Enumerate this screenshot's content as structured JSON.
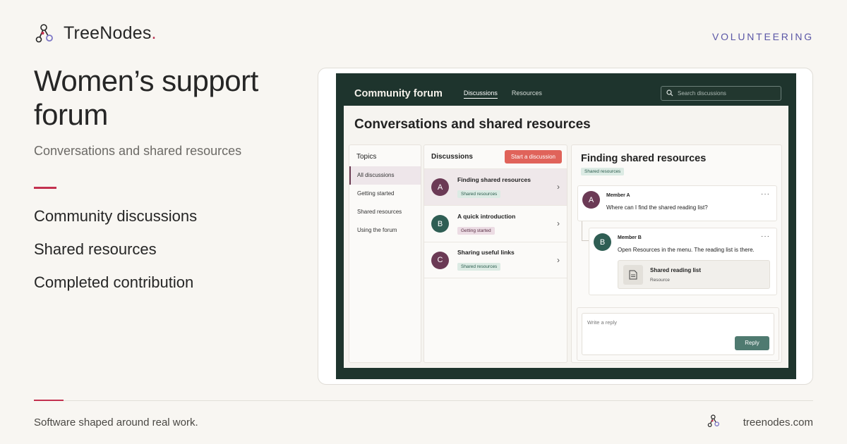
{
  "brand": {
    "name": "TreeNodes",
    "dot": "."
  },
  "category": "VOLUNTEERING",
  "hero": {
    "title": "Women’s support forum",
    "subtitle": "Conversations and shared resources"
  },
  "features": [
    "Community discussions",
    "Shared resources",
    "Completed contribution"
  ],
  "footer": {
    "tagline": "Software shaped around real work.",
    "url": "treenodes.com"
  },
  "colors": {
    "accent": "#c3314f",
    "category": "#5a56a6",
    "forum_bg": "#1e342d",
    "button": "#e0635a"
  },
  "app": {
    "title": "Community forum",
    "nav": [
      "Discussions",
      "Resources"
    ],
    "search_placeholder": "Search discussions",
    "heading": "Conversations and shared resources",
    "topics": {
      "heading": "Topics",
      "items": [
        "All discussions",
        "Getting started",
        "Shared resources",
        "Using the forum"
      ]
    },
    "discussions": {
      "heading": "Discussions",
      "start_button": "Start a discussion",
      "items": [
        {
          "initial": "A",
          "title": "Finding shared resources",
          "tag": "Shared resources"
        },
        {
          "initial": "B",
          "title": "A quick introduction",
          "tag": "Getting started"
        },
        {
          "initial": "C",
          "title": "Sharing useful links",
          "tag": "Shared resources"
        }
      ]
    },
    "thread": {
      "title": "Finding shared resources",
      "tag": "Shared resources",
      "messages": [
        {
          "initial": "A",
          "author": "Member A",
          "body": "Where can I find the shared reading list?"
        },
        {
          "initial": "B",
          "author": "Member B",
          "body": "Open Resources in the menu. The reading list is there."
        }
      ],
      "resource": {
        "title": "Shared reading list",
        "type": "Resource"
      },
      "more": "···",
      "reply_placeholder": "Write a reply",
      "reply_button": "Reply"
    }
  }
}
